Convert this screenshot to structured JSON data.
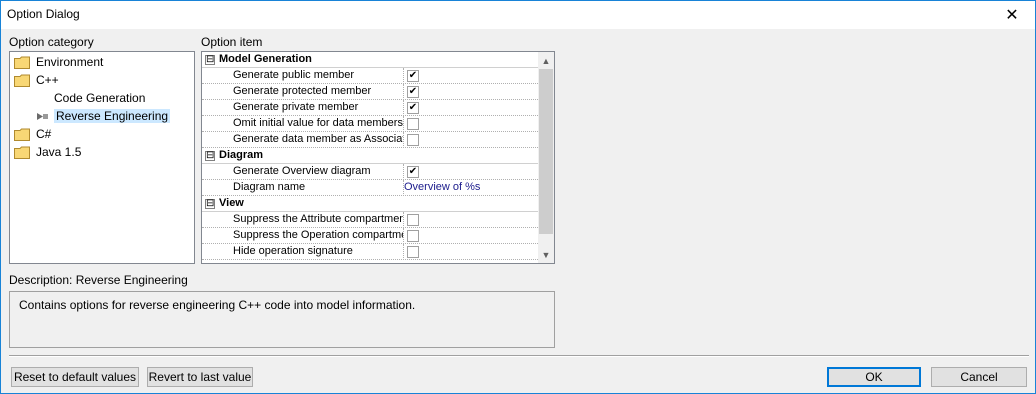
{
  "window": {
    "title": "Option Dialog",
    "close_glyph": "✕"
  },
  "category": {
    "label": "Option category",
    "items": [
      {
        "label": "Environment",
        "icon": "folder-icon"
      },
      {
        "label": "C++",
        "icon": "folder-icon"
      },
      {
        "label": "Code Generation"
      },
      {
        "label": "Reverse Engineering",
        "icon": "gear-arrow-icon",
        "selected": true
      },
      {
        "label": "C#",
        "icon": "folder-icon"
      },
      {
        "label": "Java 1.5",
        "icon": "folder-icon"
      }
    ]
  },
  "options": {
    "label": "Option item",
    "groups": [
      {
        "title": "Model Generation",
        "expander": "⊟",
        "items": [
          {
            "name": "Generate public member",
            "checked": true
          },
          {
            "name": "Generate protected member",
            "checked": true
          },
          {
            "name": "Generate private member",
            "checked": true
          },
          {
            "name": "Omit initial value for data members",
            "checked": false
          },
          {
            "name": "Generate data member as Associat",
            "checked": false
          }
        ]
      },
      {
        "title": "Diagram",
        "expander": "⊟",
        "items": [
          {
            "name": "Generate Overview diagram",
            "checked": true
          },
          {
            "name": "Diagram name",
            "value": "Overview of %s"
          }
        ]
      },
      {
        "title": "View",
        "expander": "⊟",
        "items": [
          {
            "name": "Suppress the Attribute compartmen",
            "checked": false
          },
          {
            "name": "Suppress the Operation compartme",
            "checked": false
          },
          {
            "name": "Hide operation signature",
            "checked": false
          }
        ]
      }
    ],
    "check_glyph": "✔",
    "scroll_up": "▲",
    "scroll_down": "▼"
  },
  "description": {
    "label": "Description: Reverse Engineering",
    "text": "Contains options for reverse engineering C++ code into model information."
  },
  "buttons": {
    "reset": "Reset to default values",
    "revert": "Revert to last value",
    "ok": "OK",
    "cancel": "Cancel"
  },
  "colors": {
    "accent": "#0078d7",
    "selection": "#cce8ff",
    "value_text": "#1c1c8c"
  }
}
